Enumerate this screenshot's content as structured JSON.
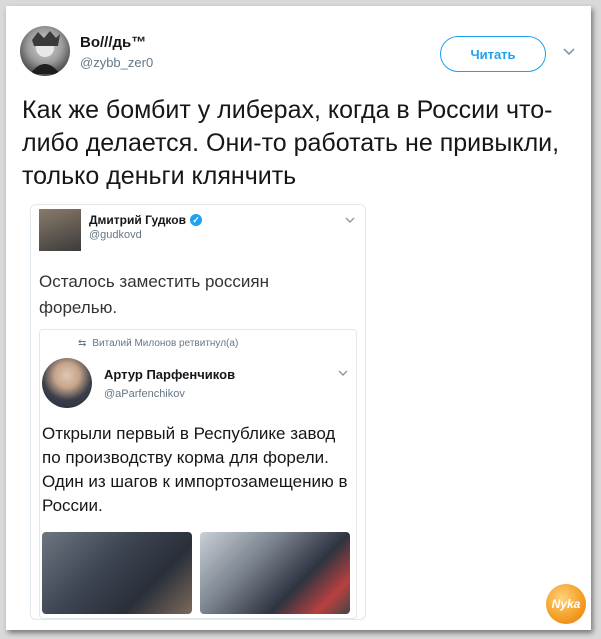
{
  "tweet": {
    "author_name": "Во///дь™",
    "author_handle": "@zybb_zer0",
    "follow_label": "Читать",
    "text": "Как же бомбит у либерах, когда в России что-либо делается. Они-то работать не привыкли, только деньги клянчить"
  },
  "quoted": {
    "author_name": "Дмитрий Гудков",
    "author_handle": "@gudkovd",
    "text": "Осталось заместить россиян форелью.",
    "retweet_note": "Виталий Милонов ретвитнул(а)",
    "inner": {
      "author_name": "Артур Парфенчиков",
      "author_handle": "@aParfenchikov",
      "text": "Открыли первый в Республике завод по производству корма для форели. Один из шагов к импортозамещению в России."
    }
  },
  "watermark_text": "Nyka",
  "colors": {
    "accent": "#1da1f2",
    "text": "#14171a",
    "muted": "#657786",
    "border": "#e1e8ed"
  },
  "icons": {
    "verified": "verified-badge-icon",
    "caret": "chevron-down-icon",
    "retweet": "retweet-icon"
  }
}
